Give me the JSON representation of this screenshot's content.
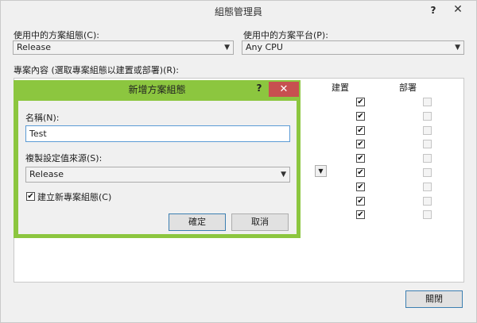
{
  "window": {
    "title": "組態管理員",
    "help_glyph": "?",
    "close_glyph": "✕"
  },
  "solution_config": {
    "label": "使用中的方案組態(C):",
    "value": "Release"
  },
  "solution_platform": {
    "label": "使用中的方案平台(P):",
    "value": "Any CPU"
  },
  "project_contexts": {
    "label": "專案內容 (選取專案組態以建置或部署)(R):",
    "columns": {
      "build": "建置",
      "deploy": "部署"
    },
    "rows": [
      {
        "build": true,
        "deploy": false
      },
      {
        "build": true,
        "deploy": false
      },
      {
        "build": true,
        "deploy": false
      },
      {
        "build": true,
        "deploy": false
      },
      {
        "build": true,
        "deploy": false
      },
      {
        "build": true,
        "deploy": false
      },
      {
        "build": true,
        "deploy": false
      },
      {
        "build": true,
        "deploy": false
      },
      {
        "build": true,
        "deploy": false
      }
    ]
  },
  "close_button": {
    "label": "關閉"
  },
  "dialog": {
    "title": "新增方案組態",
    "help_glyph": "?",
    "close_glyph": "✕",
    "name_label": "名稱(N):",
    "name_value": "Test",
    "copy_from_label": "複製設定值來源(S):",
    "copy_from_value": "Release",
    "create_new_label": "建立新專案組態(C)",
    "create_new_checked": true,
    "ok_label": "確定",
    "cancel_label": "取消"
  },
  "colors": {
    "dialog_frame": "#8cc63f",
    "close_red": "#c75050",
    "focus_blue": "#5b9bd5"
  }
}
